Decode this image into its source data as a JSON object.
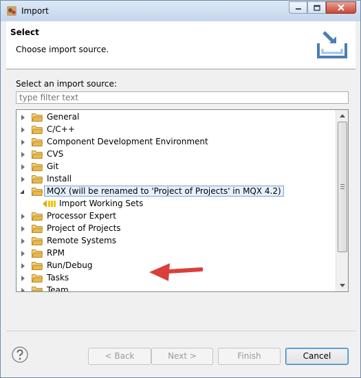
{
  "window": {
    "title": "Import"
  },
  "header": {
    "title": "Select",
    "description": "Choose import source."
  },
  "source": {
    "label": "Select an import source:",
    "filter_placeholder": "type filter text"
  },
  "tree": [
    {
      "label": "General",
      "expanded": false
    },
    {
      "label": "C/C++",
      "expanded": false
    },
    {
      "label": "Component Development Environment",
      "expanded": false
    },
    {
      "label": "CVS",
      "expanded": false
    },
    {
      "label": "Git",
      "expanded": false
    },
    {
      "label": "Install",
      "expanded": false
    },
    {
      "label": "MQX (will be renamed to 'Project of Projects' in MQX 4.2)",
      "expanded": true,
      "selected": true
    },
    {
      "label": "Import Working Sets",
      "child": true
    },
    {
      "label": "Processor Expert",
      "expanded": false
    },
    {
      "label": "Project of Projects",
      "expanded": false
    },
    {
      "label": "Remote Systems",
      "expanded": false
    },
    {
      "label": "RPM",
      "expanded": false
    },
    {
      "label": "Run/Debug",
      "expanded": false
    },
    {
      "label": "Tasks",
      "expanded": false
    },
    {
      "label": "Team",
      "expanded": false
    }
  ],
  "buttons": {
    "back": "< Back",
    "next": "Next >",
    "finish": "Finish",
    "cancel": "Cancel"
  },
  "colors": {
    "folder": "#e8b84a",
    "arrow": "#d9403a",
    "accent": "#3c7fb1"
  },
  "icons": [
    "import-app-icon",
    "minimize-icon",
    "maximize-icon",
    "close-icon",
    "import-banner-icon",
    "folder-icon",
    "working-sets-icon",
    "help-icon"
  ]
}
